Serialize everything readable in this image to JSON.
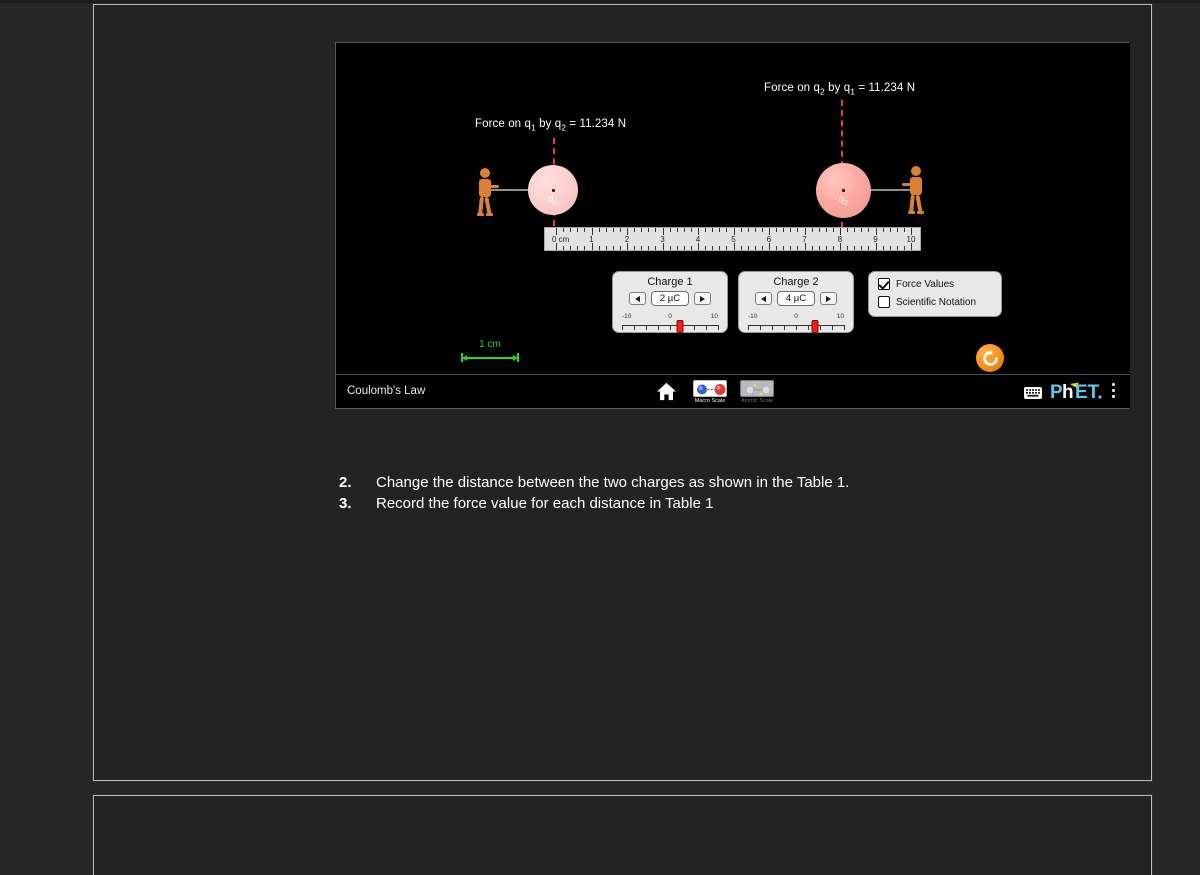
{
  "document": {
    "instructions": [
      {
        "number": "2.",
        "text": "Change the distance between the two charges as shown in the Table 1."
      },
      {
        "number": "3.",
        "text": "Record the force value for each distance in Table 1"
      }
    ]
  },
  "sim": {
    "title": "Coulomb's Law",
    "force_label_left": "Force on q₁ by q₂ = 11.234 N",
    "force_label_right": "Force on q₂ by q₁ = 11.234 N",
    "force_left": {
      "prefix": "Force on q",
      "sub1": "1",
      "mid": " by q",
      "sub2": "2",
      "suffix": " = 11.234 N"
    },
    "force_right": {
      "prefix": "Force on q",
      "sub1": "2",
      "mid": " by q",
      "sub2": "1",
      "suffix": " = 11.234 N"
    },
    "force_value": "11.234 N",
    "charge1_label": {
      "base": "q",
      "sub": "1"
    },
    "charge2_label": {
      "base": "q",
      "sub": "2"
    },
    "scale_legend": "1 cm",
    "ruler": {
      "unit_label": "0 cm",
      "numbers": [
        "1",
        "2",
        "3",
        "4",
        "5",
        "6",
        "7",
        "8",
        "9",
        "10"
      ],
      "max_cm": 10
    },
    "charge1_panel": {
      "title": "Charge 1",
      "value": "2 µC",
      "min_label": "-10",
      "center_label": "0",
      "max_label": "10",
      "slider_value": 2,
      "slider_min": -10,
      "slider_max": 10,
      "decrement_icon": "left-triangle-icon",
      "increment_icon": "right-triangle-icon"
    },
    "charge2_panel": {
      "title": "Charge 2",
      "value": "4 µC",
      "min_label": "-10",
      "center_label": "0",
      "max_label": "10",
      "slider_value": 4,
      "slider_min": -10,
      "slider_max": 10,
      "decrement_icon": "left-triangle-icon",
      "increment_icon": "right-triangle-icon"
    },
    "checkboxes": [
      {
        "label": "Force Values",
        "checked": true
      },
      {
        "label": "Scientific Notation",
        "checked": false
      }
    ],
    "reset_button": {
      "icon": "reset-circular-arrow-icon",
      "color": "#f39019"
    },
    "navbar": {
      "title": "Coulomb's Law",
      "home_icon": "home-icon",
      "tabs": [
        {
          "label": "Macro Scale",
          "selected": true,
          "icon": "macro-scale-thumbnail"
        },
        {
          "label": "Atomic Scale",
          "selected": false,
          "icon": "atomic-scale-thumbnail"
        }
      ],
      "keyboard_icon": "keyboard-shortcuts-icon",
      "logo": {
        "p": "P",
        "h": "h",
        "et": "ET",
        "dot": "."
      },
      "menu_icon": "kebab-menu-icon"
    }
  },
  "colors": {
    "page_background": "#232323",
    "app_background": "#272727",
    "sim_background": "#000000",
    "force_arrow": "#ef3d3d",
    "scale_legend": "#27d427",
    "slider_thumb": "#ef1d1d",
    "reset_orange": "#f39019",
    "phet_blue": "#5fc8e8",
    "phet_yellow": "#ffd400",
    "puller": "#d98236"
  }
}
